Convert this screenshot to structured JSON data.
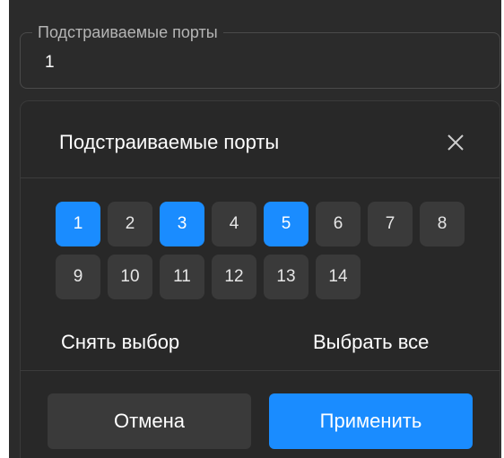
{
  "field": {
    "label": "Подстраиваемые порты",
    "value": "1"
  },
  "dialog": {
    "title": "Подстраиваемые порты",
    "ports_row1": [
      {
        "label": "1",
        "selected": true
      },
      {
        "label": "2",
        "selected": false
      },
      {
        "label": "3",
        "selected": true
      },
      {
        "label": "4",
        "selected": false
      },
      {
        "label": "5",
        "selected": true
      },
      {
        "label": "6",
        "selected": false
      },
      {
        "label": "7",
        "selected": false
      },
      {
        "label": "8",
        "selected": false
      }
    ],
    "ports_row2": [
      {
        "label": "9",
        "selected": false
      },
      {
        "label": "10",
        "selected": false
      },
      {
        "label": "11",
        "selected": false
      },
      {
        "label": "12",
        "selected": false
      },
      {
        "label": "13",
        "selected": false
      },
      {
        "label": "14",
        "selected": false
      }
    ],
    "deselect_label": "Снять выбор",
    "select_all_label": "Выбрать все",
    "cancel_label": "Отмена",
    "apply_label": "Применить"
  },
  "colors": {
    "accent": "#1a8cff",
    "port_bg": "#3a3a3a",
    "background": "#2b2b2b"
  }
}
